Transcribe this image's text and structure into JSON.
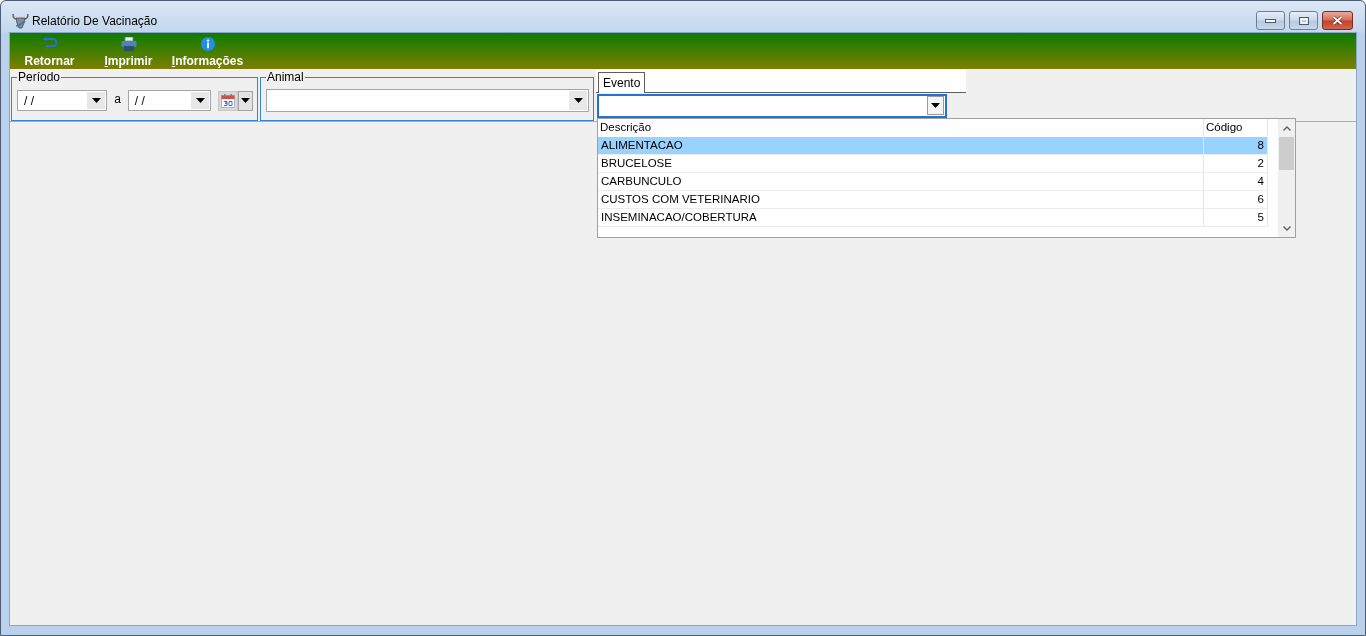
{
  "window": {
    "title": "Relatório De Vacinação"
  },
  "toolbar": [
    {
      "kind": "return",
      "label": "Retornar",
      "mnemonic": false
    },
    {
      "kind": "print",
      "label": "Imprimir",
      "mnemonic": true
    },
    {
      "kind": "info",
      "label": "Informações",
      "mnemonic": true
    }
  ],
  "period": {
    "label": "Período",
    "from": "/ /",
    "separator": "a",
    "to": "/ /"
  },
  "animal": {
    "label": "Animal"
  },
  "event": {
    "tabs": [
      {
        "label": "Evento",
        "selected": true
      }
    ],
    "focused": true,
    "expanded": true,
    "dropdown": {
      "columns": [
        "Descrição",
        "Código"
      ],
      "rows": [
        {
          "description": "ALIMENTACAO",
          "code": "8",
          "selected": true
        },
        {
          "description": "BRUCELOSE",
          "code": "2",
          "selected": false
        },
        {
          "description": "CARBUNCULO",
          "code": "4",
          "selected": false
        },
        {
          "description": "CUSTOS COM VETERINARIO",
          "code": "6",
          "selected": false
        },
        {
          "description": "INSEMINACAO/COBERTURA",
          "code": "5",
          "selected": false
        }
      ]
    }
  }
}
